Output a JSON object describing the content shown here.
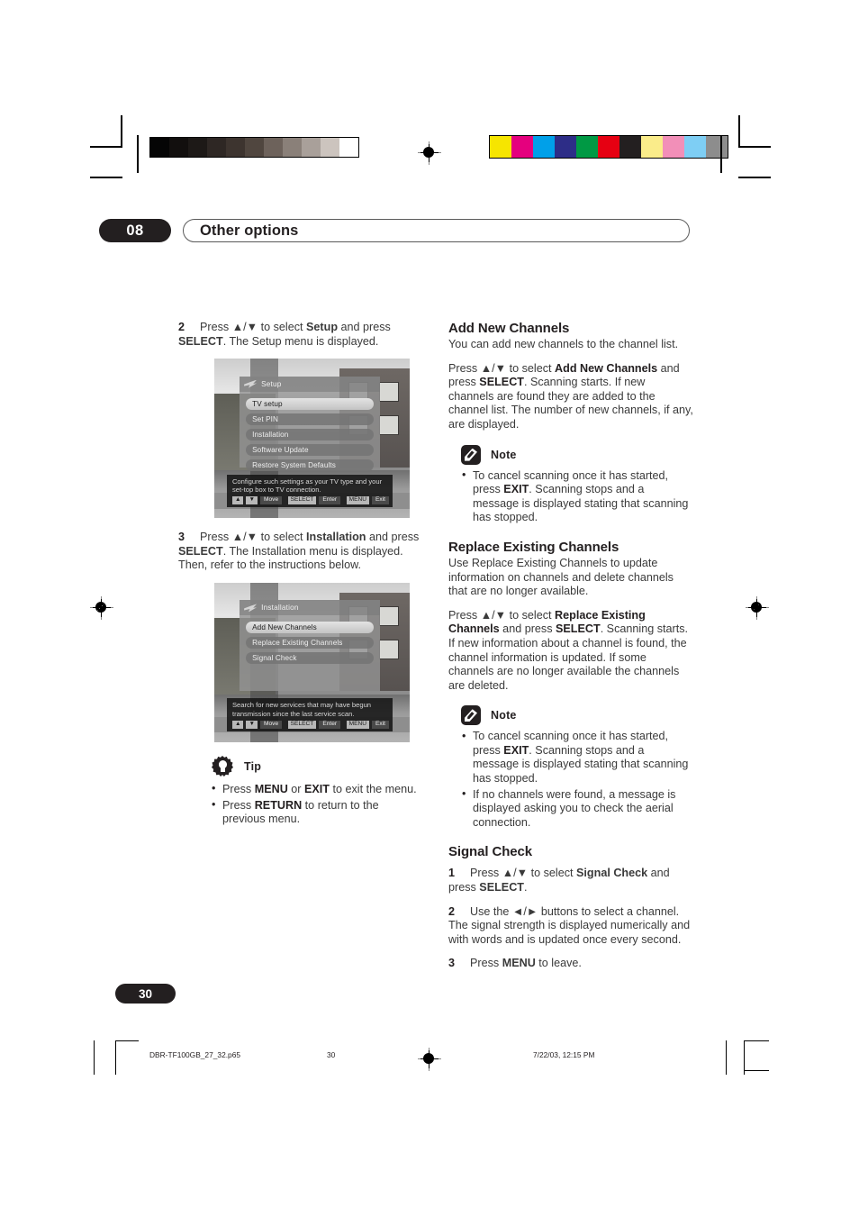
{
  "header": {
    "chapter_number": "08",
    "chapter_title": "Other options"
  },
  "left_column": {
    "step2": {
      "number": "2",
      "text_parts": [
        "Press ▲/▼ to select ",
        "Setup",
        " and press ",
        "SELECT",
        ". The Setup menu is displayed."
      ]
    },
    "setup_screenshot": {
      "title": "Setup",
      "items": [
        "TV setup",
        "Set PIN",
        "Installation",
        "Software Update",
        "Restore System Defaults"
      ],
      "selected_index": 0,
      "help_text": "Configure such settings as your TV type and your set-top box to TV connection.",
      "keys": [
        {
          "box": "▲",
          "label": ""
        },
        {
          "box": "▼",
          "label": "Move"
        },
        {
          "box": "SELECT",
          "label": "Enter"
        },
        {
          "box": "MENU",
          "label": "Exit"
        }
      ]
    },
    "step3": {
      "number": "3",
      "text_parts": [
        "Press ▲/▼ to select ",
        "Installation",
        " and press ",
        "SELECT",
        ". The Installation menu is displayed. Then, refer to the instructions below."
      ]
    },
    "installation_screenshot": {
      "title": "Installation",
      "items": [
        "Add New Channels",
        "Replace Existing Channels",
        "Signal Check"
      ],
      "selected_index": 0,
      "help_text": "Search for new services that may have begun transmission since the last service scan.",
      "keys": [
        {
          "box": "▲",
          "label": ""
        },
        {
          "box": "▼",
          "label": "Move"
        },
        {
          "box": "SELECT",
          "label": "Enter"
        },
        {
          "box": "MENU",
          "label": "Exit"
        }
      ]
    },
    "tip": {
      "label": "Tip",
      "icon": "lightbulb-icon",
      "bullets": [
        {
          "parts": [
            "Press ",
            "MENU",
            " or ",
            "EXIT",
            " to exit the menu."
          ]
        },
        {
          "parts": [
            "Press ",
            "RETURN",
            " to return to the previous menu."
          ]
        }
      ]
    }
  },
  "right_column": {
    "add_new_channels": {
      "heading": "Add New Channels",
      "paragraph1": "You can add new channels to the channel list.",
      "paragraph2_parts": [
        "Press ▲/▼ to select ",
        "Add New Channels",
        " and press ",
        "SELECT",
        ". Scanning starts. If new channels are found they are added to the channel list. The number of new channels, if any, are displayed."
      ],
      "note": {
        "label": "Note",
        "icon": "pencil-icon",
        "bullets": [
          {
            "parts": [
              "To cancel scanning once it has started, press ",
              "EXIT",
              ". Scanning stops and a message is displayed stating that scanning has stopped."
            ]
          }
        ]
      }
    },
    "replace_existing_channels": {
      "heading": "Replace Existing Channels",
      "paragraph1": "Use Replace Existing Channels to update information on channels and delete channels that are no longer available.",
      "paragraph2_parts": [
        "Press ▲/▼ to select ",
        "Replace Existing Channels",
        " and press ",
        "SELECT",
        ". Scanning starts. If new information about a channel is found, the channel information is updated. If some channels are no longer available the channels are deleted."
      ],
      "note": {
        "label": "Note",
        "icon": "pencil-icon",
        "bullets": [
          {
            "parts": [
              "To cancel scanning once it has started, press ",
              "EXIT",
              ". Scanning stops and a message is displayed stating that scanning has stopped."
            ]
          },
          {
            "parts": [
              "If no channels were found, a message is displayed asking you to check the aerial connection."
            ]
          }
        ]
      }
    },
    "signal_check": {
      "heading": "Signal Check",
      "steps": [
        {
          "number": "1",
          "parts": [
            "Press ▲/▼ to select ",
            "Signal Check",
            " and press ",
            "SELECT",
            "."
          ]
        },
        {
          "number": "2",
          "parts": [
            "Use the ◄/► buttons to select a channel. The signal strength is displayed numerically and with words and is updated once every second."
          ]
        },
        {
          "number": "3",
          "parts": [
            "Press ",
            "MENU",
            " to leave."
          ]
        }
      ]
    }
  },
  "page_number": "30",
  "footer": {
    "filename": "DBR-TF100GB_27_32.p65",
    "page": "30",
    "timestamp": "7/22/03, 12:15 PM"
  },
  "print_marks": {
    "grayscale_steps": [
      "#050505",
      "#120f0e",
      "#1d1917",
      "#2e2724",
      "#3d342f",
      "#50463f",
      "#6d625b",
      "#8a8079",
      "#a9a09a",
      "#ccc4be",
      "#ffffff"
    ],
    "color_steps": [
      "#f6e500",
      "#e5007e",
      "#00a0e9",
      "#2d2d87",
      "#009944",
      "#e60012",
      "#231f20",
      "#faec8a",
      "#f28fb8",
      "#7ecef4",
      "#8d8d8d"
    ]
  }
}
